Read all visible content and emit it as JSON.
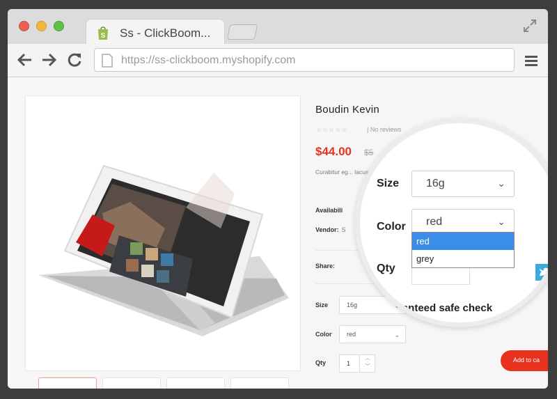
{
  "browser": {
    "tab_title": "Ss - ClickBoom...",
    "url": "https://ss-clickboom.myshopify.com"
  },
  "product": {
    "title": "Boudin Kevin",
    "stars": "☆☆☆☆☆",
    "reviews": "| No reviews",
    "price": "$44.00",
    "price_old": "$5",
    "description": "Curabitur eg... lacus. Pellen... lacus lacus lacus... lacus lacus... lacus lacus...",
    "availability_label": "Availabili",
    "vendor_label": "Vendor:",
    "vendor_value": "S",
    "share_label": "Share:",
    "size_label": "Size",
    "size_value": "16g",
    "color_label": "Color",
    "color_value": "red",
    "qty_label": "Qty",
    "qty_value": "1",
    "add_to_cart": "Add to ca"
  },
  "magnifier": {
    "size_label": "Size",
    "size_value": "16g",
    "color_label": "Color",
    "color_value": "red",
    "options": [
      "red",
      "grey"
    ],
    "qty_label": "Qty",
    "safe_checkout": "ranteed safe check"
  },
  "colors": {
    "accent": "#e6331d",
    "select_highlight": "#3b8ee8"
  }
}
